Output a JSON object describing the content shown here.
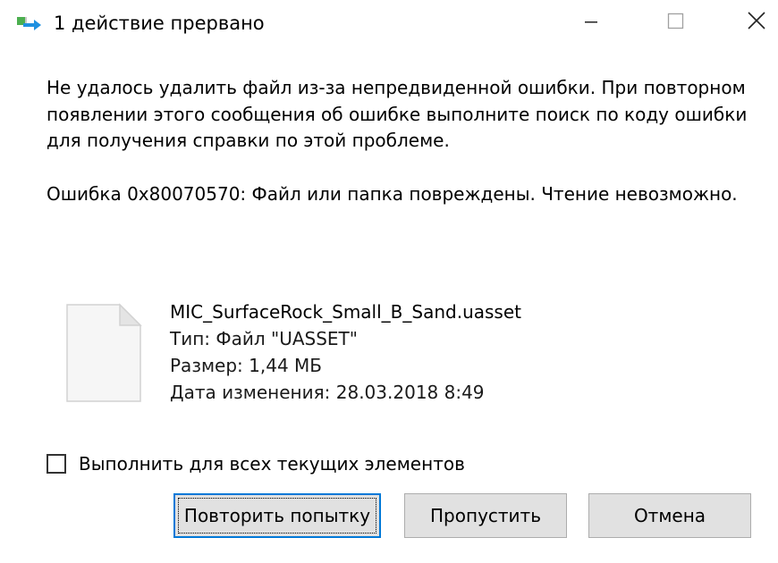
{
  "window": {
    "title": "1 действие прервано",
    "icon": "file-move-icon",
    "controls": [
      "minimize-icon",
      "maximize-icon",
      "close-icon"
    ]
  },
  "message": {
    "line1": "Не удалось удалить файл из-за непредвиденной ошибки. При повторном появлении этого сообщения об ошибке выполните поиск по коду ошибки для получения справки по этой проблеме.",
    "line2": "Ошибка 0x80070570: Файл или папка повреждены. Чтение невозможно."
  },
  "file": {
    "icon": "blank-file-icon",
    "name": "MIC_SurfaceRock_Small_B_Sand.uasset",
    "type": "Тип: Файл \"UASSET\"",
    "size": "Размер: 1,44 МБ",
    "modified": "Дата изменения: 28.03.2018 8:49"
  },
  "apply_all": {
    "label": "Выполнить для всех текущих элементов",
    "checked": false
  },
  "buttons": {
    "retry": "Повторить попытку",
    "skip": "Пропустить",
    "cancel": "Отмена"
  },
  "colors": {
    "focus_border": "#0078d7",
    "button_bg": "#e1e1e1",
    "button_border": "#adadad"
  }
}
